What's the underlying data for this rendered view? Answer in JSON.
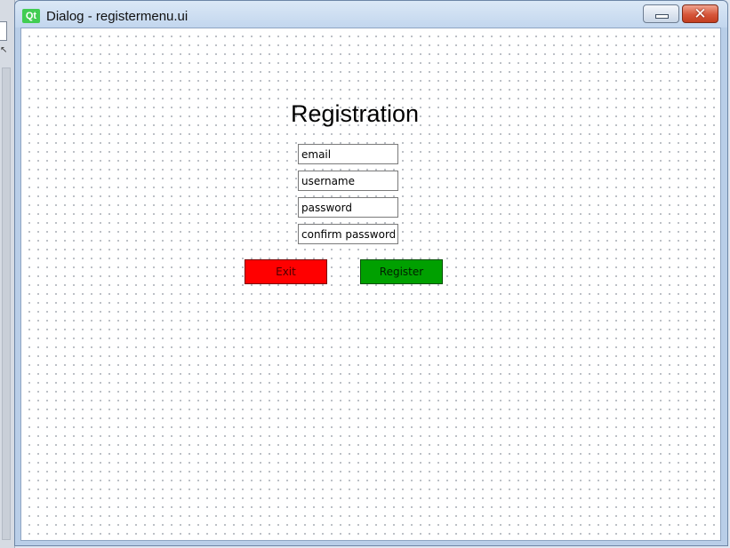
{
  "window": {
    "title": "Dialog - registermenu.ui",
    "logo_text": "Qt",
    "controls": {
      "minimize_icon": "minimize-icon",
      "close_icon": "close-icon",
      "close_glyph": "✕"
    }
  },
  "form": {
    "heading": "Registration",
    "fields": {
      "email": "email",
      "username": "username",
      "password": "password",
      "confirm_password": "confirm password"
    },
    "buttons": {
      "exit": "Exit",
      "register": "Register"
    }
  },
  "colors": {
    "exit_button": "#ff0000",
    "register_button": "#00a000",
    "qt_brand": "#41cd52",
    "close_button": "#c33d1f"
  }
}
